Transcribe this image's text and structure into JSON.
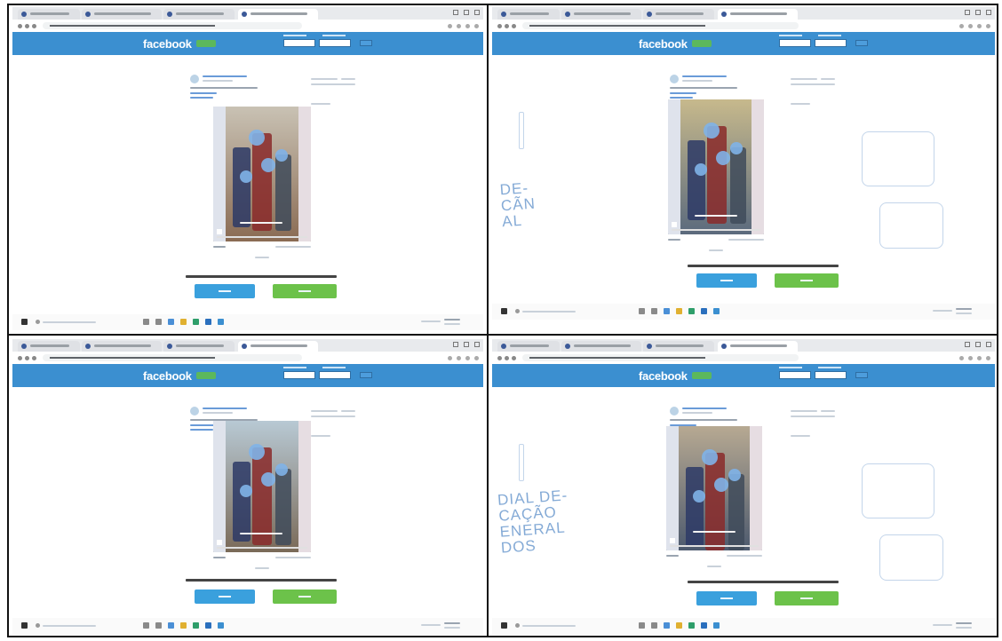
{
  "page": {
    "panels": [
      {
        "id": "p1",
        "logo": "facebook",
        "handwriting": []
      },
      {
        "id": "p2",
        "logo": "facebook",
        "handwriting": [
          "DE-",
          "CÃN",
          "AL"
        ]
      },
      {
        "id": "p3",
        "logo": "facebook",
        "handwriting": []
      },
      {
        "id": "p4",
        "logo": "facebook",
        "handwriting": [
          "DIAL DE-",
          "CAÇÃO",
          "ENERAL",
          "DOS"
        ]
      }
    ]
  },
  "colors": {
    "fb_blue": "#3b8fd0",
    "fb_badge": "#5cb85c",
    "cta_blue": "#3aa0dd",
    "cta_green": "#6cc24a",
    "blur_blue": "#7fb3e8",
    "ink": "#6f9ccf"
  },
  "icons": [
    "facebook-logo",
    "avatar-icon",
    "windows-start-icon",
    "search-icon",
    "taskbar-app-icon"
  ]
}
